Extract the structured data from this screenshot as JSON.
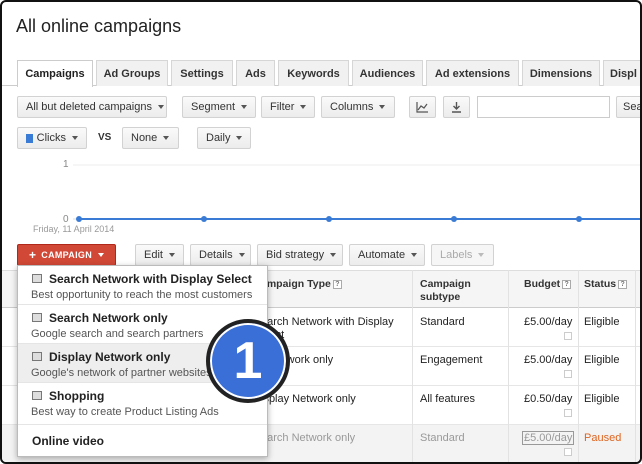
{
  "page": {
    "title": "All online campaigns"
  },
  "tabs": [
    {
      "label": "Campaigns"
    },
    {
      "label": "Ad Groups"
    },
    {
      "label": "Settings"
    },
    {
      "label": "Ads"
    },
    {
      "label": "Keywords"
    },
    {
      "label": "Audiences"
    },
    {
      "label": "Ad extensions"
    },
    {
      "label": "Dimensions"
    },
    {
      "label": "Displ"
    }
  ],
  "toolbar": {
    "filter_campaigns": "All but deleted campaigns",
    "segment": "Segment",
    "filter": "Filter",
    "columns": "Columns",
    "search_value": "",
    "search_button": "Sea"
  },
  "chart_controls": {
    "metric1": "Clicks",
    "vs": "VS",
    "metric2": "None",
    "period": "Daily"
  },
  "chart_data": {
    "type": "line",
    "y_ticks": [
      "1",
      "0"
    ],
    "date_label": "Friday, 11 April 2014",
    "series": [
      {
        "values": [
          0,
          0,
          0,
          0,
          0,
          0,
          0
        ]
      }
    ],
    "ylim": [
      0,
      1
    ],
    "color": "#3a7bd5"
  },
  "actions": {
    "campaign": "CAMPAIGN",
    "edit": "Edit",
    "details": "Details",
    "bid_strategy": "Bid strategy",
    "automate": "Automate",
    "labels": "Labels"
  },
  "table": {
    "headers": {
      "campaign_type": "ampaign Type",
      "campaign_subtype_1": "Campaign",
      "campaign_subtype_2": "subtype",
      "budget": "Budget",
      "status": "Status"
    },
    "rows": [
      {
        "type_1": "earch Network with Display",
        "type_2": "elect",
        "subtype": "Standard",
        "budget": "£5.00/day",
        "status": "Eligible",
        "paused": false
      },
      {
        "type_1": "y Network only",
        "type_2": "",
        "subtype": "Engagement",
        "budget": "£5.00/day",
        "status": "Eligible",
        "paused": false
      },
      {
        "type_1": "isplay Network only",
        "type_2": "",
        "subtype": "All features",
        "budget": "£0.50/day",
        "status": "Eligible",
        "paused": false
      },
      {
        "type_1": "earch Network only",
        "type_2": "",
        "subtype": "Standard",
        "budget": "£5.00/day",
        "status": "Paused",
        "paused": true
      }
    ]
  },
  "menu": {
    "items": [
      {
        "label": "Search Network with Display Select",
        "desc": "Best opportunity to reach the most customers"
      },
      {
        "label": "Search Network only",
        "desc": "Google search and search partners"
      },
      {
        "label": "Display Network only",
        "desc": "Google's network of partner websites"
      },
      {
        "label": "Shopping",
        "desc": "Best way to create Product Listing Ads"
      },
      {
        "label": "Online video",
        "desc": ""
      }
    ]
  },
  "badge": {
    "number": "1"
  },
  "colors": {
    "accent": "#d14836",
    "chart": "#3a7bd5",
    "paused": "#e0641f",
    "badge": "#3a6fd8"
  }
}
